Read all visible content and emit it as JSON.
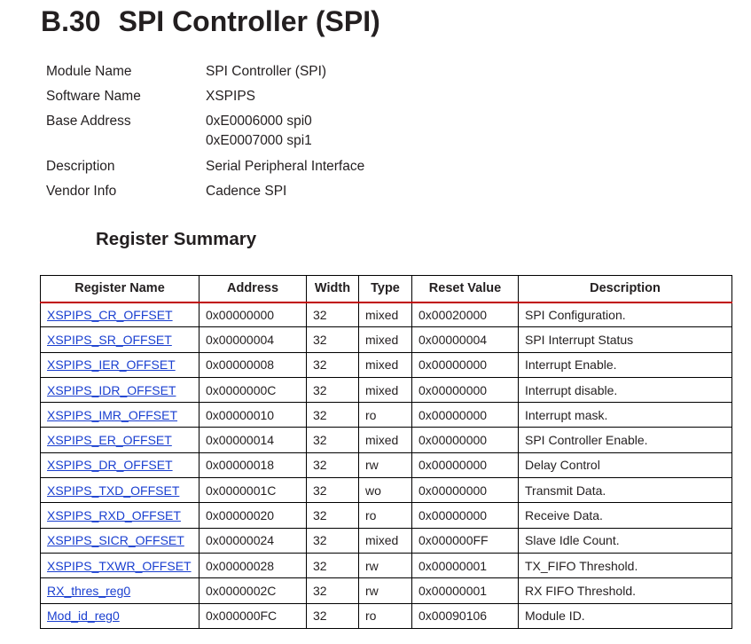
{
  "section": {
    "number": "B.30",
    "title": "SPI Controller (SPI)"
  },
  "module_info": [
    {
      "label": "Module Name",
      "values": [
        "SPI Controller (SPI)"
      ]
    },
    {
      "label": "Software Name",
      "values": [
        "XSPIPS"
      ]
    },
    {
      "label": "Base Address",
      "values": [
        "0xE0006000 spi0",
        "0xE0007000 spi1"
      ]
    },
    {
      "label": "Description",
      "values": [
        "Serial Peripheral Interface"
      ]
    },
    {
      "label": "Vendor Info",
      "values": [
        "Cadence SPI"
      ]
    }
  ],
  "register_summary": {
    "heading": "Register Summary",
    "columns": [
      "Register Name",
      "Address",
      "Width",
      "Type",
      "Reset Value",
      "Description"
    ],
    "rows": [
      {
        "name": "XSPIPS_CR_OFFSET",
        "address": "0x00000000",
        "width": "32",
        "type": "mixed",
        "reset_value": "0x00020000",
        "description": "SPI Configuration."
      },
      {
        "name": "XSPIPS_SR_OFFSET",
        "address": "0x00000004",
        "width": "32",
        "type": "mixed",
        "reset_value": "0x00000004",
        "description": "SPI Interrupt Status"
      },
      {
        "name": "XSPIPS_IER_OFFSET",
        "address": "0x00000008",
        "width": "32",
        "type": "mixed",
        "reset_value": "0x00000000",
        "description": "Interrupt Enable."
      },
      {
        "name": "XSPIPS_IDR_OFFSET",
        "address": "0x0000000C",
        "width": "32",
        "type": "mixed",
        "reset_value": "0x00000000",
        "description": "Interrupt disable."
      },
      {
        "name": "XSPIPS_IMR_OFFSET",
        "address": "0x00000010",
        "width": "32",
        "type": "ro",
        "reset_value": "0x00000000",
        "description": "Interrupt mask."
      },
      {
        "name": "XSPIPS_ER_OFFSET",
        "address": "0x00000014",
        "width": "32",
        "type": "mixed",
        "reset_value": "0x00000000",
        "description": "SPI Controller Enable."
      },
      {
        "name": "XSPIPS_DR_OFFSET",
        "address": "0x00000018",
        "width": "32",
        "type": "rw",
        "reset_value": "0x00000000",
        "description": "Delay Control"
      },
      {
        "name": "XSPIPS_TXD_OFFSET",
        "address": "0x0000001C",
        "width": "32",
        "type": "wo",
        "reset_value": "0x00000000",
        "description": "Transmit Data."
      },
      {
        "name": "XSPIPS_RXD_OFFSET",
        "address": "0x00000020",
        "width": "32",
        "type": "ro",
        "reset_value": "0x00000000",
        "description": "Receive Data."
      },
      {
        "name": "XSPIPS_SICR_OFFSET",
        "address": "0x00000024",
        "width": "32",
        "type": "mixed",
        "reset_value": "0x000000FF",
        "description": "Slave Idle Count."
      },
      {
        "name": "XSPIPS_TXWR_OFFSET",
        "address": "0x00000028",
        "width": "32",
        "type": "rw",
        "reset_value": "0x00000001",
        "description": "TX_FIFO Threshold."
      },
      {
        "name": "RX_thres_reg0",
        "address": "0x0000002C",
        "width": "32",
        "type": "rw",
        "reset_value": "0x00000001",
        "description": "RX FIFO Threshold."
      },
      {
        "name": "Mod_id_reg0",
        "address": "0x000000FC",
        "width": "32",
        "type": "ro",
        "reset_value": "0x00090106",
        "description": "Module ID."
      }
    ]
  },
  "colors": {
    "text": "#231f20",
    "link": "#1a3fd0",
    "header_rule": "#c00000",
    "table_border": "#000000",
    "background": "#ffffff"
  }
}
